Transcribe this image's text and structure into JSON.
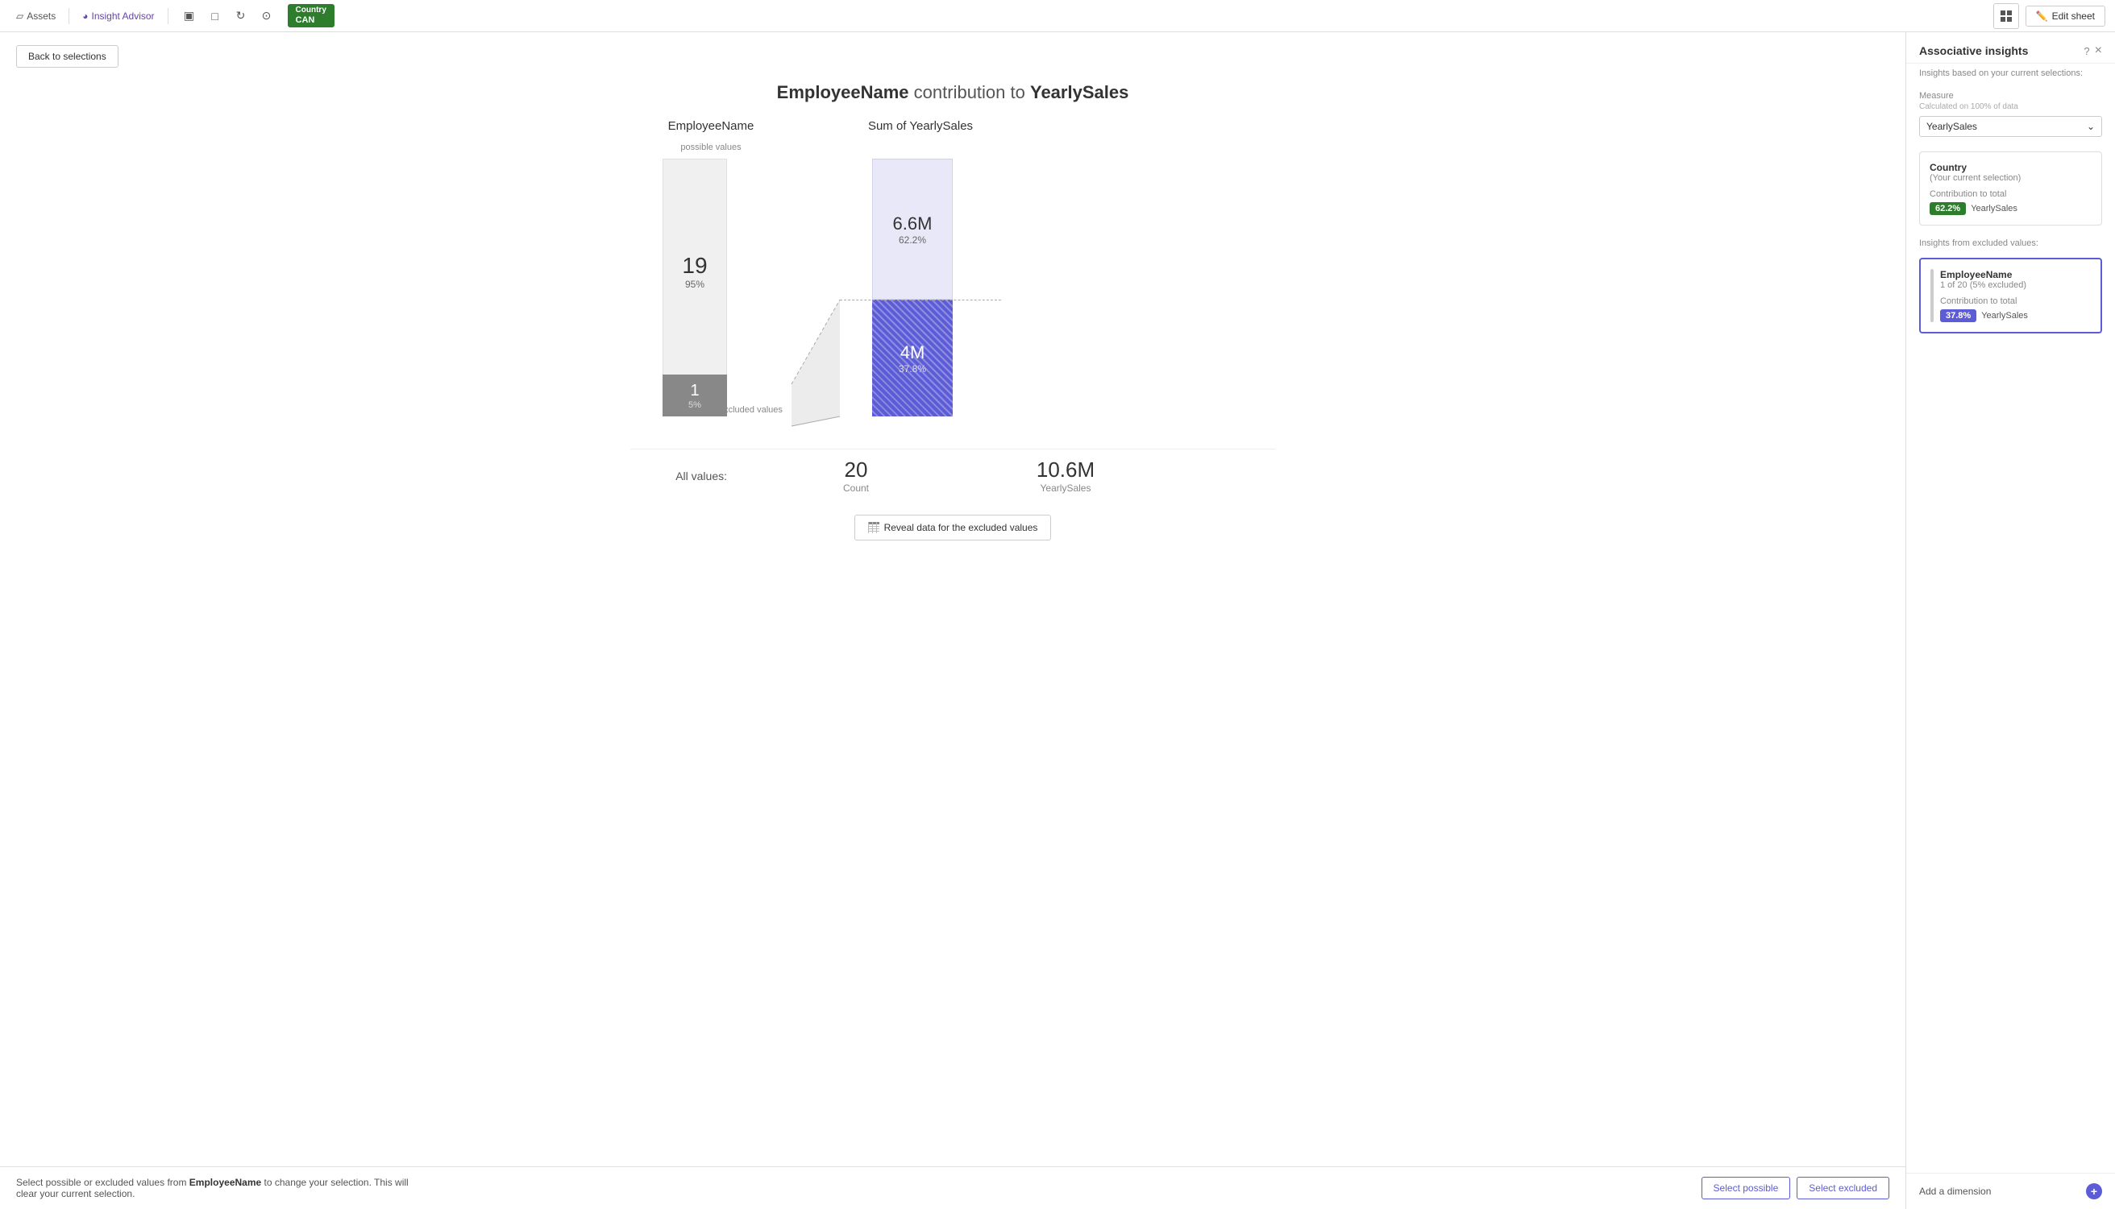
{
  "topbar": {
    "assets_label": "Assets",
    "insight_label": "Insight Advisor",
    "country_label": "Country",
    "country_value": "CAN",
    "edit_sheet_label": "Edit sheet"
  },
  "back_button": "Back to selections",
  "chart": {
    "title_field": "EmployeeName",
    "title_connector": "contribution to",
    "title_measure": "YearlySales",
    "left_col_header": "EmployeeName",
    "right_col_header": "Sum of YearlySales",
    "possible_label": "possible values",
    "excluded_label": "excluded values",
    "possible_count": "19",
    "possible_pct": "95%",
    "excluded_count": "1",
    "excluded_pct": "5%",
    "sum_possible": "6.6M",
    "sum_possible_pct": "62.2%",
    "sum_excluded": "4M",
    "sum_excluded_pct": "37.8%",
    "all_values_label": "All values:",
    "all_count": "20",
    "all_count_label": "Count",
    "all_sum": "10.6M",
    "all_sum_label": "YearlySales",
    "reveal_btn_label": "Reveal data for the excluded values"
  },
  "bottom_bar": {
    "text_prefix": "Select possible or excluded values from",
    "field_name": "EmployeeName",
    "text_suffix": "to change your selection. This will clear your current selection.",
    "select_possible": "Select possible",
    "select_excluded": "Select excluded"
  },
  "right_panel": {
    "title": "Associative insights",
    "close_label": "×",
    "subtitle": "Insights based on your current selections:",
    "measure_label": "Measure",
    "measure_sub": "Calculated on 100% of data",
    "measure_value": "YearlySales",
    "country_section_title": "Country",
    "country_section_sub": "(Your current selection)",
    "country_contribution_label": "Contribution to total",
    "country_pct": "62.2%",
    "country_measure": "YearlySales",
    "excluded_section_label": "Insights from excluded values:",
    "excluded_field_title": "EmployeeName",
    "excluded_field_sub": "1 of 20 (5% excluded)",
    "excluded_contribution_label": "Contribution to total",
    "excluded_pct": "37.8%",
    "excluded_measure": "YearlySales",
    "add_dimension_label": "Add a dimension"
  }
}
